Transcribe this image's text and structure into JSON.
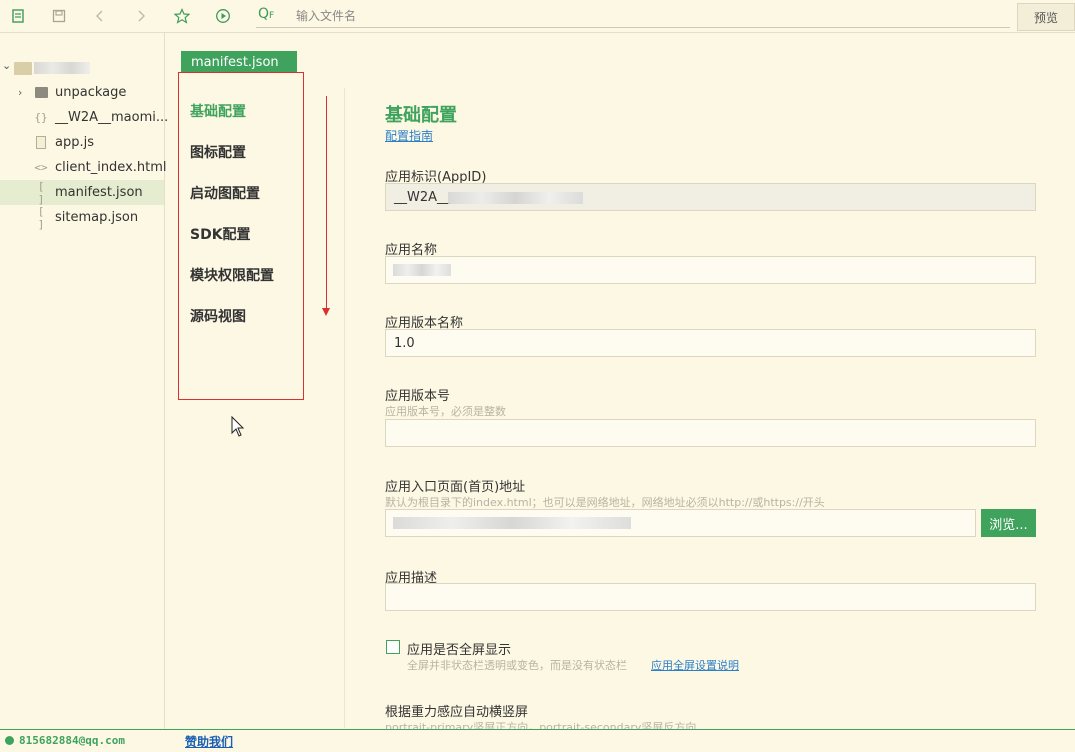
{
  "colors": {
    "accent": "#3fa35e",
    "background": "#fdf8e4",
    "link": "#2a7fc9",
    "annotation": "#d93030"
  },
  "toolbar": {
    "icons": [
      "new-file-icon",
      "save-icon",
      "back-icon",
      "forward-icon",
      "star-icon",
      "run-icon"
    ],
    "search_icon_label": "Q",
    "search_icon_sub": "F",
    "search_placeholder": "输入文件名",
    "preview_label": "预览"
  },
  "sidebar": {
    "items": [
      {
        "label": "unpackage",
        "icon": "folder-icon"
      },
      {
        "label": "__W2A__maomi...",
        "icon": "json-icon"
      },
      {
        "label": "app.js",
        "icon": "js-file-icon"
      },
      {
        "label": "client_index.html",
        "icon": "html-icon"
      },
      {
        "label": "manifest.json",
        "icon": "bracket-icon",
        "selected": true
      },
      {
        "label": "sitemap.json",
        "icon": "bracket-icon"
      }
    ]
  },
  "editor": {
    "tab_label": "manifest.json"
  },
  "nav": {
    "items": [
      "基础配置",
      "图标配置",
      "启动图配置",
      "SDK配置",
      "模块权限配置",
      "源码视图"
    ],
    "active": "基础配置"
  },
  "form": {
    "title": "基础配置",
    "guide_link": "配置指南",
    "appid_label": "应用标识(AppID)",
    "appid_value": "__W2A__",
    "name_label": "应用名称",
    "version_name_label": "应用版本名称",
    "version_name_value": "1.0",
    "version_code_label": "应用版本号",
    "version_code_hint": "应用版本号，必须是整数",
    "entry_label": "应用入口页面(首页)地址",
    "entry_hint": "默认为根目录下的index.html；也可以是网络地址，网络地址必须以http://或https://开头",
    "browse_label": "浏览...",
    "desc_label": "应用描述",
    "fullscreen_label": "应用是否全屏显示",
    "fullscreen_hint": "全屏并非状态栏透明或变色，而是没有状态栏",
    "fullscreen_link": "应用全屏设置说明",
    "orientation_label": "根据重力感应自动横竖屏",
    "orientation_hint": "portrait-primary竖屏正方向，portrait-secondary竖屏反方向"
  },
  "statusbar": {
    "email": "815682884@qq.com",
    "sponsor": "赞助我们"
  }
}
